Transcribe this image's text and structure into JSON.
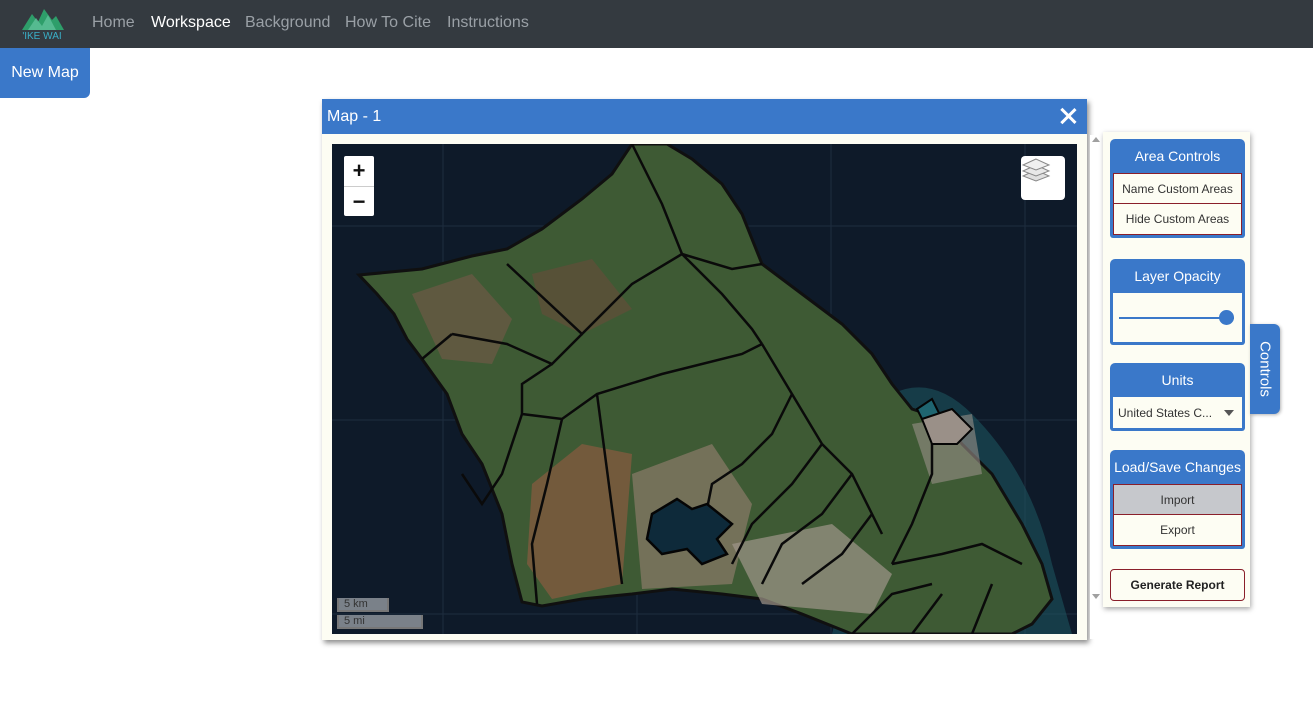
{
  "navbar": {
    "logo_text": "'IKE WAI",
    "links": [
      {
        "label": "Home"
      },
      {
        "label": "Workspace"
      },
      {
        "label": "Background"
      },
      {
        "label": "How To Cite"
      },
      {
        "label": "Instructions"
      }
    ],
    "active": "Workspace"
  },
  "new_map_label": "New Map",
  "map_window": {
    "title": "Map - 1",
    "zoom_in": "+",
    "zoom_out": "−",
    "scale_km": "5 km",
    "scale_mi": "5 mi"
  },
  "controls": {
    "tab_label": "Controls",
    "area_controls": {
      "title": "Area Controls",
      "items": [
        "Name Custom Areas",
        "Hide Custom Areas"
      ]
    },
    "layer_opacity": {
      "title": "Layer Opacity",
      "value_fraction": 1.0
    },
    "units": {
      "title": "Units",
      "selected": "United States C..."
    },
    "load_save": {
      "title": "Load/Save Changes",
      "items": [
        "Import",
        "Export"
      ]
    },
    "generate_report": "Generate Report"
  },
  "colors": {
    "navbar_bg": "#343a40",
    "accent": "#3a78c9",
    "ocean": "#0e1a29",
    "border_red": "#8a1f2a"
  }
}
